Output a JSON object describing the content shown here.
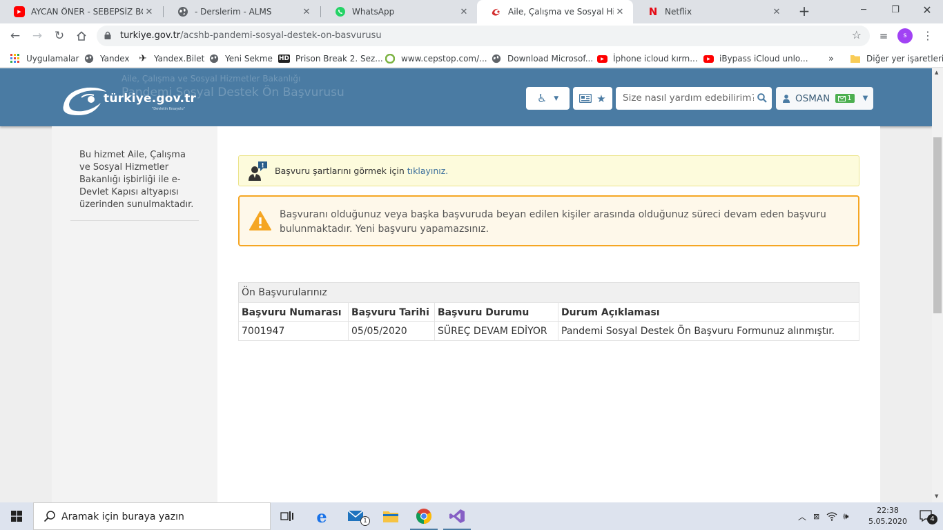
{
  "browser": {
    "tabs": [
      {
        "title": "AYCAN ÖNER - SEBEPSİZ BOŞ",
        "icon": "youtube-icon",
        "active": false
      },
      {
        "title": "- Derslerim - ALMS",
        "icon": "globe-icon",
        "active": false
      },
      {
        "title": "WhatsApp",
        "icon": "whatsapp-icon",
        "active": false
      },
      {
        "title": "Aile, Çalışma ve Sosyal Hizmetl",
        "icon": "turkiye-gov-icon",
        "active": true
      },
      {
        "title": "Netflix",
        "icon": "netflix-icon",
        "active": false
      }
    ],
    "url_domain": "turkiye.gov.tr",
    "url_path": "/acshb-pandemi-sosyal-destek-on-basvurusu",
    "profile_initial": "s",
    "bookmarks": [
      {
        "label": "Uygulamalar",
        "icon": "apps-grid-icon"
      },
      {
        "label": "Yandex",
        "icon": "globe-icon"
      },
      {
        "label": "Yandex.Bilet",
        "icon": "plane-icon"
      },
      {
        "label": "Yeni Sekme",
        "icon": "globe-icon"
      },
      {
        "label": "Prison Break 2. Sez...",
        "icon": "hd-icon"
      },
      {
        "label": "www.cepstop.com/...",
        "icon": "cepstop-icon"
      },
      {
        "label": "Download Microsof...",
        "icon": "globe-icon"
      },
      {
        "label": "İphone icloud kırm...",
        "icon": "youtube-icon"
      },
      {
        "label": "iBypass iCloud unlo...",
        "icon": "youtube-icon"
      }
    ],
    "bookmarks_more": "»",
    "other_bookmarks": "Diğer yer işaretleri"
  },
  "site": {
    "logo_text": "türkiye.gov.tr",
    "logo_tagline": "\"Devletin Kısayolu\"",
    "ghost_institution": "Aile, Çalışma ve Sosyal Hizmetler Bakanlığı",
    "ghost_title": "Pandemi Sosyal Destek Ön Başvurusu",
    "search_placeholder": "Size nasıl yardım edebilirim?",
    "user_name": "OSMAN",
    "message_count": "1"
  },
  "sidebar": {
    "text": "Bu hizmet Aile, Çalışma ve Sosyal Hizmetler Bakanlığı işbirliği ile e-Devlet Kapısı altyapısı üzerinden sunulmaktadır."
  },
  "notice": {
    "text": "Başvuru şartlarını görmek için ",
    "link": "tıklayınız."
  },
  "warning": {
    "text": "Başvuranı olduğunuz veya başka başvuruda beyan edilen kişiler arasında olduğunuz süreci devam eden başvuru bulunmaktadır. Yeni başvuru yapamazsınız."
  },
  "applications": {
    "caption": "Ön Başvurularınız",
    "headers": [
      "Başvuru Numarası",
      "Başvuru Tarihi",
      "Başvuru Durumu",
      "Durum Açıklaması"
    ],
    "rows": [
      [
        "7001947",
        "05/05/2020",
        "SÜREÇ DEVAM EDİYOR",
        "Pandemi Sosyal Destek Ön Başvuru Formunuz alınmıştır."
      ]
    ]
  },
  "taskbar": {
    "search_placeholder": "Aramak için buraya yazın",
    "mail_badge": "1",
    "time": "22:38",
    "date": "5.05.2020",
    "notification_count": "4"
  }
}
